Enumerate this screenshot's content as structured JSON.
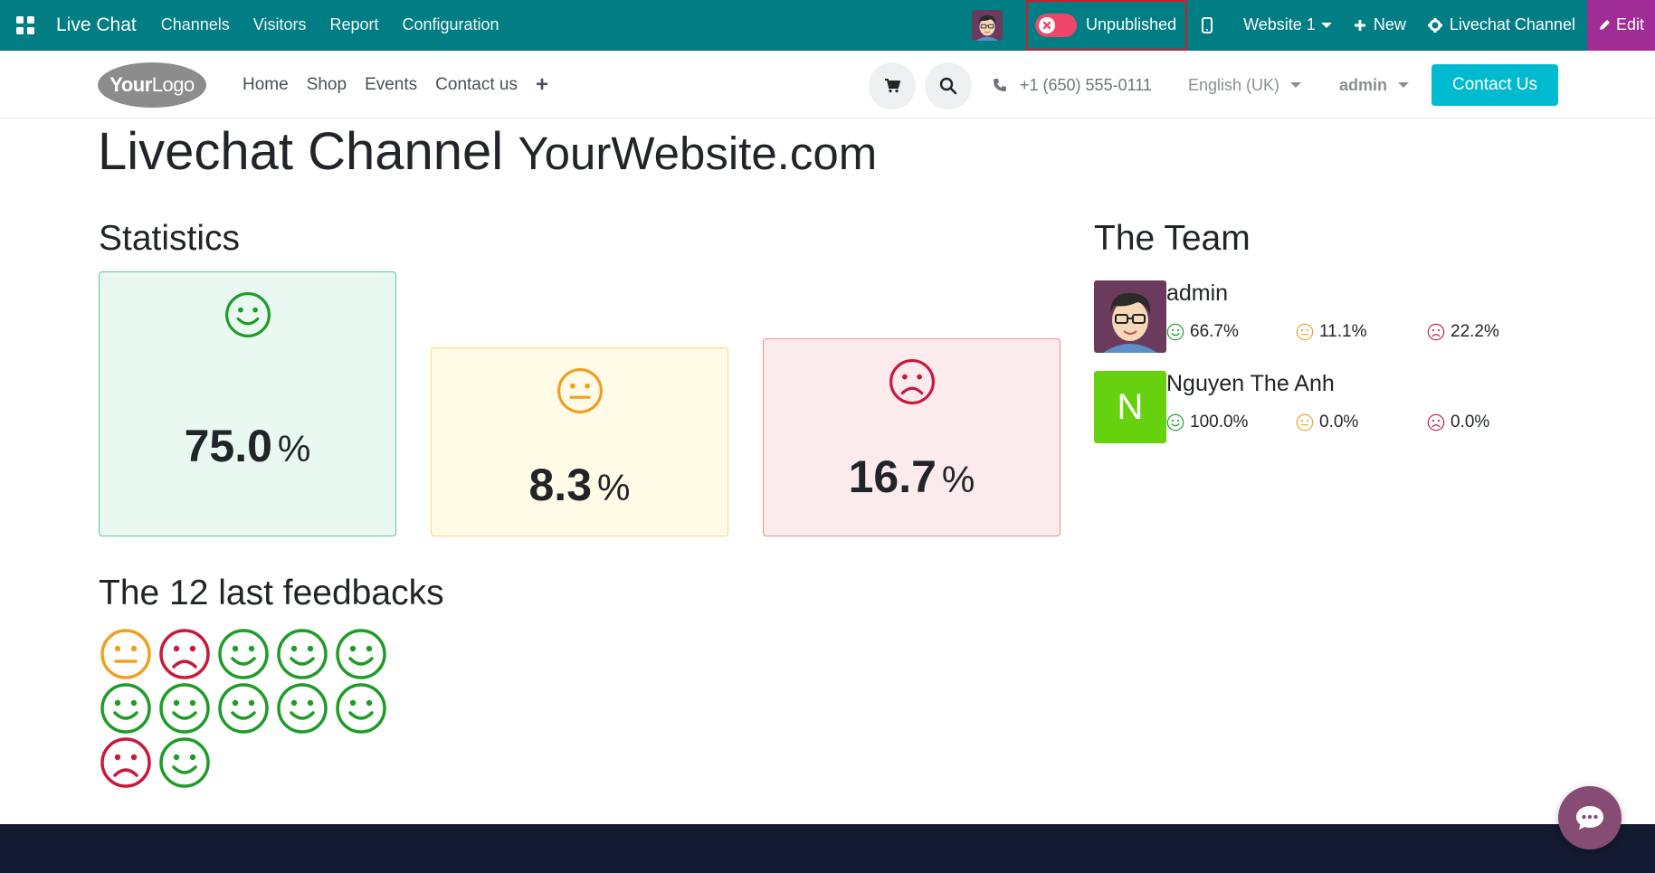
{
  "topbar": {
    "app_name": "Live Chat",
    "menus": [
      "Channels",
      "Visitors",
      "Report",
      "Configuration"
    ],
    "publish_status": "Unpublished",
    "website": "Website 1",
    "new_label": "New",
    "channel_label": "Livechat Channel",
    "edit_label": "Edit",
    "color": "#017e84",
    "edit_color": "#a02c96"
  },
  "site": {
    "logo_bold": "Your",
    "logo_light": "Logo",
    "nav": [
      "Home",
      "Shop",
      "Events",
      "Contact us"
    ],
    "phone": "+1 (650) 555-0111",
    "language": "English (UK)",
    "user": "admin",
    "contact_button": "Contact Us",
    "accent": "#00bbcf"
  },
  "page": {
    "title": "Livechat Channel",
    "title_sub": "YourWebsite.com",
    "statistics_heading": "Statistics",
    "team_heading": "The Team",
    "feedback_heading": "The 12 last feedbacks"
  },
  "statistics": {
    "happy": "75.0",
    "neutral": "8.3",
    "sad": "16.7",
    "unit": "%"
  },
  "team": [
    {
      "name": "admin",
      "happy": "66.7%",
      "neutral": "11.1%",
      "sad": "22.2%",
      "avatar": "cartoon-avatar"
    },
    {
      "name": "Nguyen The Anh",
      "initial": "N",
      "happy": "100.0%",
      "neutral": "0.0%",
      "sad": "0.0%"
    }
  ],
  "feedbacks": [
    "neutral",
    "sad",
    "happy",
    "happy",
    "happy",
    "happy",
    "happy",
    "happy",
    "happy",
    "happy",
    "sad",
    "happy"
  ],
  "colors": {
    "happy": "#1e9c27",
    "neutral": "#f0a020",
    "sad": "#c8193c"
  }
}
